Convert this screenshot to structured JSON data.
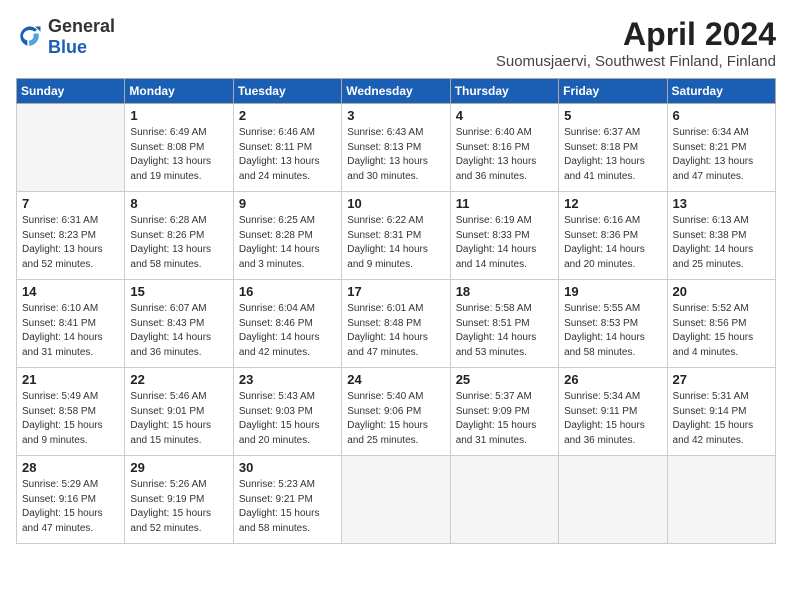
{
  "header": {
    "logo_general": "General",
    "logo_blue": "Blue",
    "month_title": "April 2024",
    "location": "Suomusjaervi, Southwest Finland, Finland"
  },
  "weekdays": [
    "Sunday",
    "Monday",
    "Tuesday",
    "Wednesday",
    "Thursday",
    "Friday",
    "Saturday"
  ],
  "weeks": [
    [
      {
        "day": "",
        "empty": true
      },
      {
        "day": "1",
        "sunrise": "6:49 AM",
        "sunset": "8:08 PM",
        "daylight": "13 hours and 19 minutes."
      },
      {
        "day": "2",
        "sunrise": "6:46 AM",
        "sunset": "8:11 PM",
        "daylight": "13 hours and 24 minutes."
      },
      {
        "day": "3",
        "sunrise": "6:43 AM",
        "sunset": "8:13 PM",
        "daylight": "13 hours and 30 minutes."
      },
      {
        "day": "4",
        "sunrise": "6:40 AM",
        "sunset": "8:16 PM",
        "daylight": "13 hours and 36 minutes."
      },
      {
        "day": "5",
        "sunrise": "6:37 AM",
        "sunset": "8:18 PM",
        "daylight": "13 hours and 41 minutes."
      },
      {
        "day": "6",
        "sunrise": "6:34 AM",
        "sunset": "8:21 PM",
        "daylight": "13 hours and 47 minutes."
      }
    ],
    [
      {
        "day": "7",
        "sunrise": "6:31 AM",
        "sunset": "8:23 PM",
        "daylight": "13 hours and 52 minutes."
      },
      {
        "day": "8",
        "sunrise": "6:28 AM",
        "sunset": "8:26 PM",
        "daylight": "13 hours and 58 minutes."
      },
      {
        "day": "9",
        "sunrise": "6:25 AM",
        "sunset": "8:28 PM",
        "daylight": "14 hours and 3 minutes."
      },
      {
        "day": "10",
        "sunrise": "6:22 AM",
        "sunset": "8:31 PM",
        "daylight": "14 hours and 9 minutes."
      },
      {
        "day": "11",
        "sunrise": "6:19 AM",
        "sunset": "8:33 PM",
        "daylight": "14 hours and 14 minutes."
      },
      {
        "day": "12",
        "sunrise": "6:16 AM",
        "sunset": "8:36 PM",
        "daylight": "14 hours and 20 minutes."
      },
      {
        "day": "13",
        "sunrise": "6:13 AM",
        "sunset": "8:38 PM",
        "daylight": "14 hours and 25 minutes."
      }
    ],
    [
      {
        "day": "14",
        "sunrise": "6:10 AM",
        "sunset": "8:41 PM",
        "daylight": "14 hours and 31 minutes."
      },
      {
        "day": "15",
        "sunrise": "6:07 AM",
        "sunset": "8:43 PM",
        "daylight": "14 hours and 36 minutes."
      },
      {
        "day": "16",
        "sunrise": "6:04 AM",
        "sunset": "8:46 PM",
        "daylight": "14 hours and 42 minutes."
      },
      {
        "day": "17",
        "sunrise": "6:01 AM",
        "sunset": "8:48 PM",
        "daylight": "14 hours and 47 minutes."
      },
      {
        "day": "18",
        "sunrise": "5:58 AM",
        "sunset": "8:51 PM",
        "daylight": "14 hours and 53 minutes."
      },
      {
        "day": "19",
        "sunrise": "5:55 AM",
        "sunset": "8:53 PM",
        "daylight": "14 hours and 58 minutes."
      },
      {
        "day": "20",
        "sunrise": "5:52 AM",
        "sunset": "8:56 PM",
        "daylight": "15 hours and 4 minutes."
      }
    ],
    [
      {
        "day": "21",
        "sunrise": "5:49 AM",
        "sunset": "8:58 PM",
        "daylight": "15 hours and 9 minutes."
      },
      {
        "day": "22",
        "sunrise": "5:46 AM",
        "sunset": "9:01 PM",
        "daylight": "15 hours and 15 minutes."
      },
      {
        "day": "23",
        "sunrise": "5:43 AM",
        "sunset": "9:03 PM",
        "daylight": "15 hours and 20 minutes."
      },
      {
        "day": "24",
        "sunrise": "5:40 AM",
        "sunset": "9:06 PM",
        "daylight": "15 hours and 25 minutes."
      },
      {
        "day": "25",
        "sunrise": "5:37 AM",
        "sunset": "9:09 PM",
        "daylight": "15 hours and 31 minutes."
      },
      {
        "day": "26",
        "sunrise": "5:34 AM",
        "sunset": "9:11 PM",
        "daylight": "15 hours and 36 minutes."
      },
      {
        "day": "27",
        "sunrise": "5:31 AM",
        "sunset": "9:14 PM",
        "daylight": "15 hours and 42 minutes."
      }
    ],
    [
      {
        "day": "28",
        "sunrise": "5:29 AM",
        "sunset": "9:16 PM",
        "daylight": "15 hours and 47 minutes."
      },
      {
        "day": "29",
        "sunrise": "5:26 AM",
        "sunset": "9:19 PM",
        "daylight": "15 hours and 52 minutes."
      },
      {
        "day": "30",
        "sunrise": "5:23 AM",
        "sunset": "9:21 PM",
        "daylight": "15 hours and 58 minutes."
      },
      {
        "day": "",
        "empty": true
      },
      {
        "day": "",
        "empty": true
      },
      {
        "day": "",
        "empty": true
      },
      {
        "day": "",
        "empty": true
      }
    ]
  ]
}
